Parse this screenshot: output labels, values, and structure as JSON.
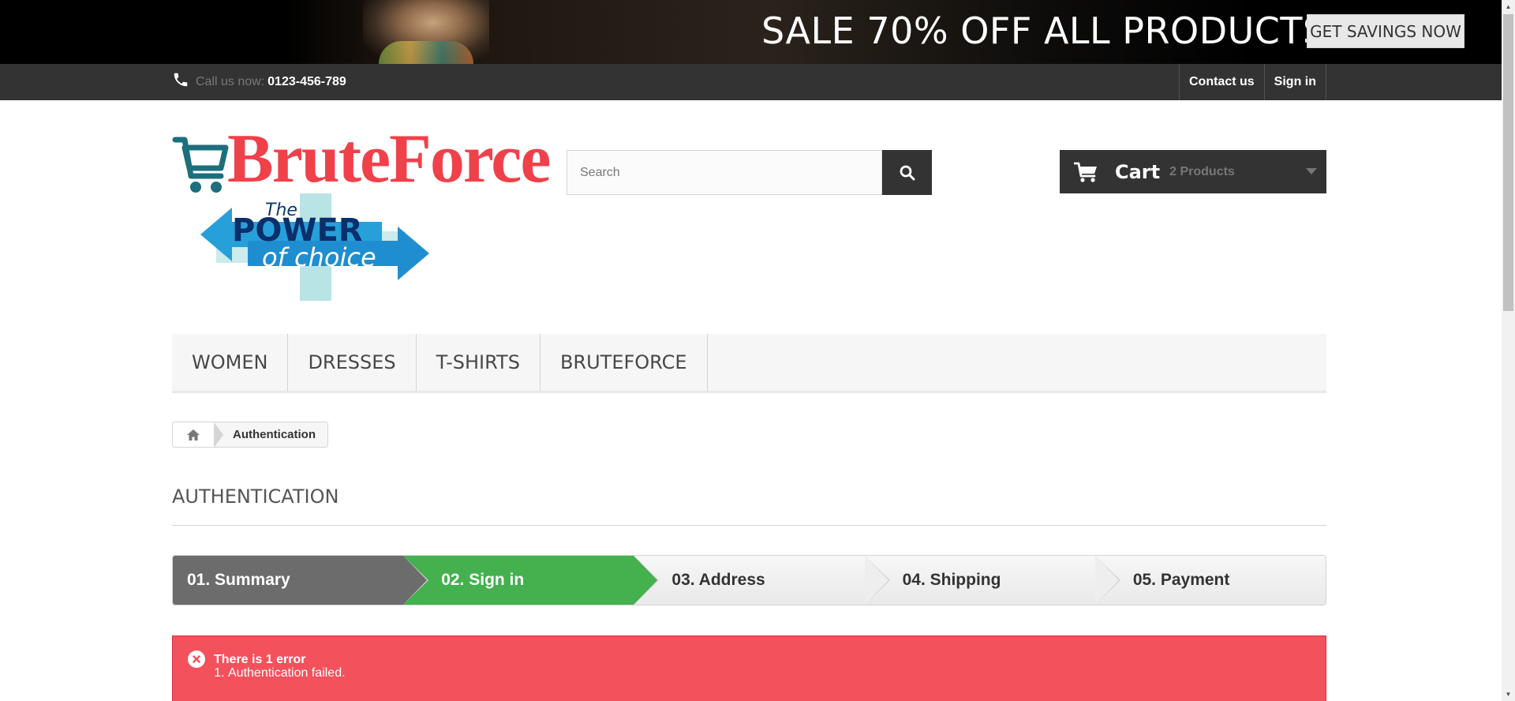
{
  "banner": {
    "headline": "SALE 70% OFF ALL PRODUCTS",
    "cta_label": "GET SAVINGS NOW"
  },
  "topnav": {
    "call_label": "Call us now:",
    "phone": "0123-456-789",
    "links": [
      "Contact us",
      "Sign in"
    ]
  },
  "logo": {
    "brand": "BruteForce",
    "tagline_the": "The",
    "tagline_power": "POWER",
    "tagline_choice": "of choice"
  },
  "search": {
    "placeholder": "Search"
  },
  "cart": {
    "title": "Cart",
    "count_label": "2 Products"
  },
  "menu": {
    "items": [
      "WOMEN",
      "DRESSES",
      "T-SHIRTS",
      "BRUTEFORCE"
    ]
  },
  "breadcrumb": {
    "current": "Authentication"
  },
  "page": {
    "heading": "AUTHENTICATION"
  },
  "steps": {
    "items": [
      "01. Summary",
      "02. Sign in",
      "03. Address",
      "04. Shipping",
      "05. Payment"
    ],
    "current_index": 1
  },
  "alert": {
    "title": "There is 1 error",
    "errors": [
      "Authentication failed."
    ]
  },
  "colors": {
    "topbar": "#333333",
    "brand_red": "#f0414b",
    "step_done": "#6c6c6c",
    "step_current": "#44b04e",
    "alert_bg": "#f3515c"
  }
}
